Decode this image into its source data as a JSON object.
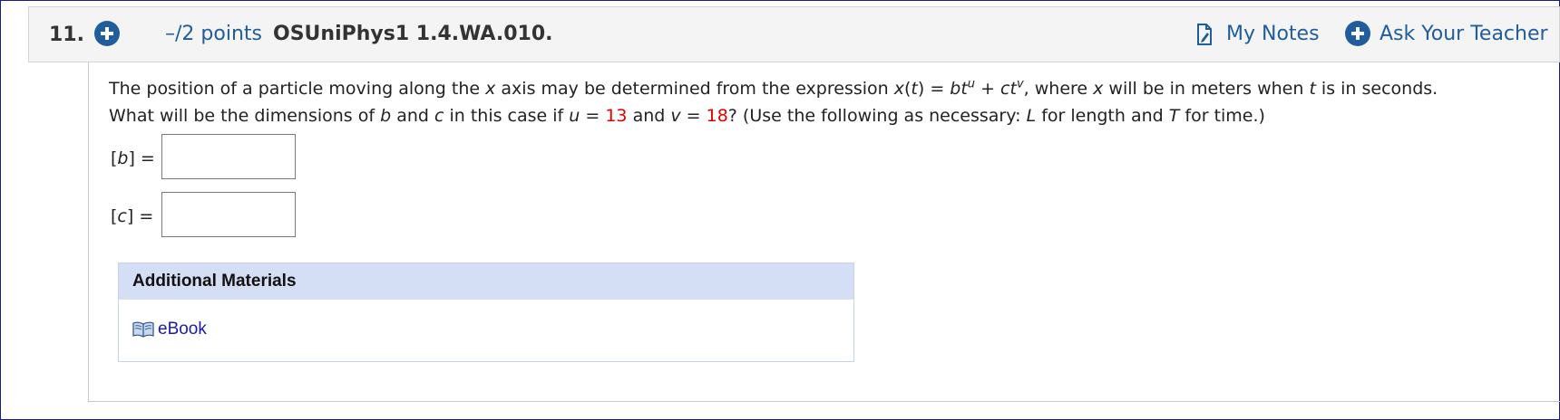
{
  "question": {
    "number": "11.",
    "points": "–/2 points",
    "title": "OSUniPhys1 1.4.WA.010.",
    "my_notes": "My Notes",
    "ask_teacher": "Ask Your Teacher",
    "text": {
      "p1": "The position of a particle moving along the ",
      "x1": "x",
      "p2": " axis may be determined from the expression ",
      "xt_x": "x",
      "xt_open": "(",
      "xt_t": "t",
      "xt_close": ")",
      "eq1": " = ",
      "b": "b",
      "t1": "t",
      "u_sup": "u",
      "plus": " + ",
      "c": "c",
      "t2": "t",
      "v_sup": "v",
      "p3": ", where ",
      "x2": "x",
      "p4": " will be in meters when ",
      "t3": "t",
      "p5": " is in seconds. What will be the dimensions of ",
      "b2": "b",
      "p6": " and ",
      "c2": "c",
      "p7": " in this case if ",
      "u": "u",
      "eq2": " = ",
      "u_value": "13",
      "p8": " and ",
      "v": "v",
      "eq3": " = ",
      "v_value": "18",
      "p9": "? (Use the following as necessary: ",
      "L": "L",
      "p10": " for length and ",
      "T": "T",
      "p11": " for time.)"
    },
    "answers": [
      {
        "open": "[",
        "var": "b",
        "close": "] =",
        "value": ""
      },
      {
        "open": "[",
        "var": "c",
        "close": "] =",
        "value": ""
      }
    ]
  },
  "additional_materials": {
    "header": "Additional Materials",
    "ebook": "eBook"
  },
  "colors": {
    "accent": "#1f5d9c",
    "highlight_value": "#e00000",
    "materials_header_bg": "#d4def5",
    "link": "#1a1aa8"
  },
  "icons": [
    "plus-circle-icon",
    "notes-icon",
    "book-icon"
  ]
}
